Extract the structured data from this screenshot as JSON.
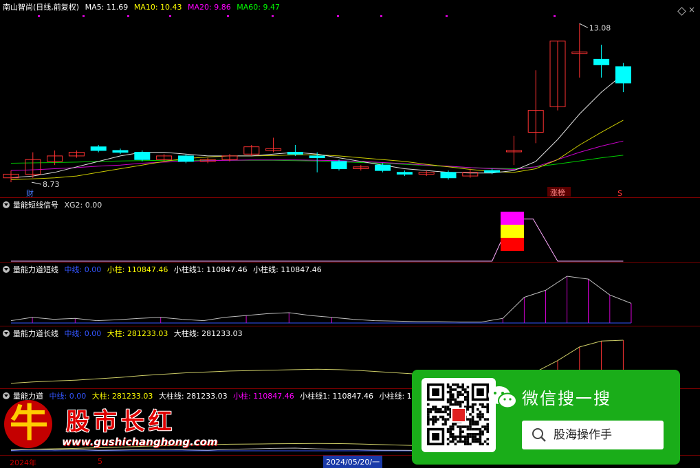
{
  "main": {
    "title": "南山智尚",
    "subtitle": "(日线,前复权)",
    "ma": [
      {
        "label": "MA5: 11.69",
        "color": "#ffffff"
      },
      {
        "label": "MA10: 10.43",
        "color": "#ffff00"
      },
      {
        "label": "MA20: 9.86",
        "color": "#ff00ff"
      },
      {
        "label": "MA60: 9.47",
        "color": "#00ff00"
      }
    ],
    "high_label": "13.08",
    "low_label": "8.73",
    "cai_label": "财",
    "zhang_label": "涨榜",
    "s_label": "S",
    "candles": [
      {
        "o": 8.85,
        "c": 8.95,
        "h": 9.05,
        "l": 8.73
      },
      {
        "o": 8.95,
        "c": 9.35,
        "h": 9.55,
        "l": 8.85
      },
      {
        "o": 9.3,
        "c": 9.45,
        "h": 9.6,
        "l": 9.2
      },
      {
        "o": 9.45,
        "c": 9.55,
        "h": 9.6,
        "l": 9.4
      },
      {
        "o": 9.7,
        "c": 9.6,
        "h": 9.75,
        "l": 9.55
      },
      {
        "o": 9.6,
        "c": 9.55,
        "h": 9.65,
        "l": 9.5
      },
      {
        "o": 9.55,
        "c": 9.35,
        "h": 9.6,
        "l": 9.3
      },
      {
        "o": 9.35,
        "c": 9.45,
        "h": 9.5,
        "l": 9.3
      },
      {
        "o": 9.45,
        "c": 9.3,
        "h": 9.5,
        "l": 9.25
      },
      {
        "o": 9.3,
        "c": 9.35,
        "h": 9.4,
        "l": 9.25
      },
      {
        "o": 9.35,
        "c": 9.45,
        "h": 9.5,
        "l": 9.3
      },
      {
        "o": 9.5,
        "c": 9.7,
        "h": 9.75,
        "l": 9.45
      },
      {
        "o": 9.6,
        "c": 9.65,
        "h": 9.95,
        "l": 9.55
      },
      {
        "o": 9.55,
        "c": 9.5,
        "h": 9.75,
        "l": 9.45
      },
      {
        "o": 9.45,
        "c": 9.4,
        "h": 9.55,
        "l": 9.0
      },
      {
        "o": 9.3,
        "c": 9.1,
        "h": 9.35,
        "l": 9.05
      },
      {
        "o": 9.1,
        "c": 9.15,
        "h": 9.2,
        "l": 9.05
      },
      {
        "o": 9.2,
        "c": 9.05,
        "h": 9.25,
        "l": 9.0
      },
      {
        "o": 9.0,
        "c": 8.95,
        "h": 9.05,
        "l": 8.9
      },
      {
        "o": 8.95,
        "c": 9.0,
        "h": 9.05,
        "l": 8.9
      },
      {
        "o": 9.0,
        "c": 8.85,
        "h": 9.05,
        "l": 8.8
      },
      {
        "o": 8.9,
        "c": 9.0,
        "h": 9.1,
        "l": 8.85
      },
      {
        "o": 9.05,
        "c": 9.0,
        "h": 9.1,
        "l": 8.95
      },
      {
        "o": 9.6,
        "c": 9.6,
        "h": 10.0,
        "l": 9.2
      },
      {
        "o": 10.1,
        "c": 10.7,
        "h": 11.8,
        "l": 9.8
      },
      {
        "o": 10.8,
        "c": 12.6,
        "h": 12.6,
        "l": 10.7
      },
      {
        "o": 12.3,
        "c": 12.3,
        "h": 13.08,
        "l": 11.6
      },
      {
        "o": 12.1,
        "c": 11.95,
        "h": 12.5,
        "l": 11.6
      },
      {
        "o": 11.9,
        "c": 11.45,
        "h": 12.0,
        "l": 11.2
      }
    ],
    "ma5": [
      8.85,
      8.9,
      9.0,
      9.15,
      9.3,
      9.45,
      9.55,
      9.55,
      9.5,
      9.45,
      9.45,
      9.45,
      9.5,
      9.55,
      9.5,
      9.4,
      9.3,
      9.2,
      9.1,
      9.05,
      9.0,
      8.98,
      8.98,
      9.05,
      9.3,
      9.9,
      10.6,
      11.2,
      11.69
    ],
    "ma10": [
      8.8,
      8.82,
      8.85,
      8.9,
      9.0,
      9.1,
      9.2,
      9.3,
      9.38,
      9.42,
      9.45,
      9.45,
      9.46,
      9.48,
      9.48,
      9.45,
      9.4,
      9.35,
      9.3,
      9.22,
      9.15,
      9.08,
      9.02,
      9.0,
      9.1,
      9.35,
      9.75,
      10.1,
      10.43
    ],
    "ma20": [
      9.05,
      9.07,
      9.1,
      9.13,
      9.17,
      9.2,
      9.25,
      9.28,
      9.3,
      9.32,
      9.33,
      9.34,
      9.34,
      9.34,
      9.33,
      9.32,
      9.3,
      9.27,
      9.24,
      9.2,
      9.17,
      9.13,
      9.1,
      9.08,
      9.15,
      9.35,
      9.55,
      9.72,
      9.86
    ],
    "ma60": [
      9.25,
      9.26,
      9.27,
      9.28,
      9.3,
      9.31,
      9.32,
      9.33,
      9.33,
      9.33,
      9.33,
      9.33,
      9.33,
      9.32,
      9.31,
      9.29,
      9.27,
      9.25,
      9.22,
      9.19,
      9.16,
      9.13,
      9.11,
      9.1,
      9.15,
      9.23,
      9.31,
      9.4,
      9.47
    ]
  },
  "p2": {
    "title": "量能短线信号",
    "items": [
      {
        "label": "XG2: 0.00",
        "color": "#dddddd"
      }
    ],
    "line": [
      0,
      0,
      0,
      0,
      0,
      0,
      0,
      0,
      0,
      0,
      0,
      0,
      0,
      0,
      0,
      0,
      0,
      0,
      0,
      0,
      0,
      0,
      0,
      1,
      1,
      0,
      0,
      0,
      0
    ],
    "blocks": [
      "#ff00ff",
      "#ffff00",
      "#ff0000"
    ]
  },
  "p3": {
    "title": "量能力道短线",
    "items": [
      {
        "label": "中线: 0.00",
        "color": "#3355ff"
      },
      {
        "label": "小柱: 110847.46",
        "color": "#ffff00"
      },
      {
        "label": "小柱线1: 110847.46",
        "color": "#ffffff"
      },
      {
        "label": "小柱线: 110847.46",
        "color": "#ffffff"
      }
    ],
    "line": [
      0.05,
      0.12,
      0.08,
      0.1,
      0.05,
      0.07,
      0.1,
      0.12,
      0.08,
      0.05,
      0.12,
      0.16,
      0.2,
      0.22,
      0.16,
      0.12,
      0.08,
      0.05,
      0.04,
      0.03,
      0.03,
      0.02,
      0.02,
      0.1,
      0.55,
      0.7,
      1.0,
      0.94,
      0.6,
      0.42
    ],
    "bars": [
      0,
      0,
      0,
      0,
      0,
      0,
      0,
      0,
      0,
      0,
      0,
      0,
      0,
      0,
      0,
      0,
      0,
      0,
      0,
      0,
      0,
      0,
      0,
      0,
      0.55,
      0.7,
      1.0,
      0.94,
      0.6,
      0.42
    ]
  },
  "p4": {
    "title": "量能力道长线",
    "items": [
      {
        "label": "中线: 0.00",
        "color": "#3355ff"
      },
      {
        "label": "大柱: 281233.03",
        "color": "#ffff00"
      },
      {
        "label": "大柱线: 281233.03",
        "color": "#ffffff"
      }
    ],
    "line": [
      0.05,
      0.08,
      0.1,
      0.12,
      0.15,
      0.18,
      0.22,
      0.25,
      0.28,
      0.3,
      0.32,
      0.33,
      0.34,
      0.35,
      0.36,
      0.35,
      0.33,
      0.3,
      0.27,
      0.24,
      0.2,
      0.18,
      0.16,
      0.15,
      0.3,
      0.55,
      0.85,
      0.98,
      1.0
    ]
  },
  "p5": {
    "title": "量能力道",
    "items": [
      {
        "label": "中线: 0.00",
        "color": "#3355ff"
      },
      {
        "label": "大柱: 281233.03",
        "color": "#ffff00"
      },
      {
        "label": "大柱线: 281233.03",
        "color": "#ffffff"
      },
      {
        "label": "小柱: 110847.46",
        "color": "#ff00ff"
      },
      {
        "label": "小柱线1: 110847.46",
        "color": "#ffffff"
      },
      {
        "label": "小柱线: 11",
        "color": "#ffffff"
      }
    ]
  },
  "axis": {
    "year": "2024年",
    "mark": "5",
    "date": "2024/05/20/一"
  },
  "watermark": {
    "brand": "股市长红",
    "url": "www.gushichanghong.com",
    "niu": "牛"
  },
  "wechat": {
    "title": "微信搜一搜",
    "search": "股海操作手"
  }
}
